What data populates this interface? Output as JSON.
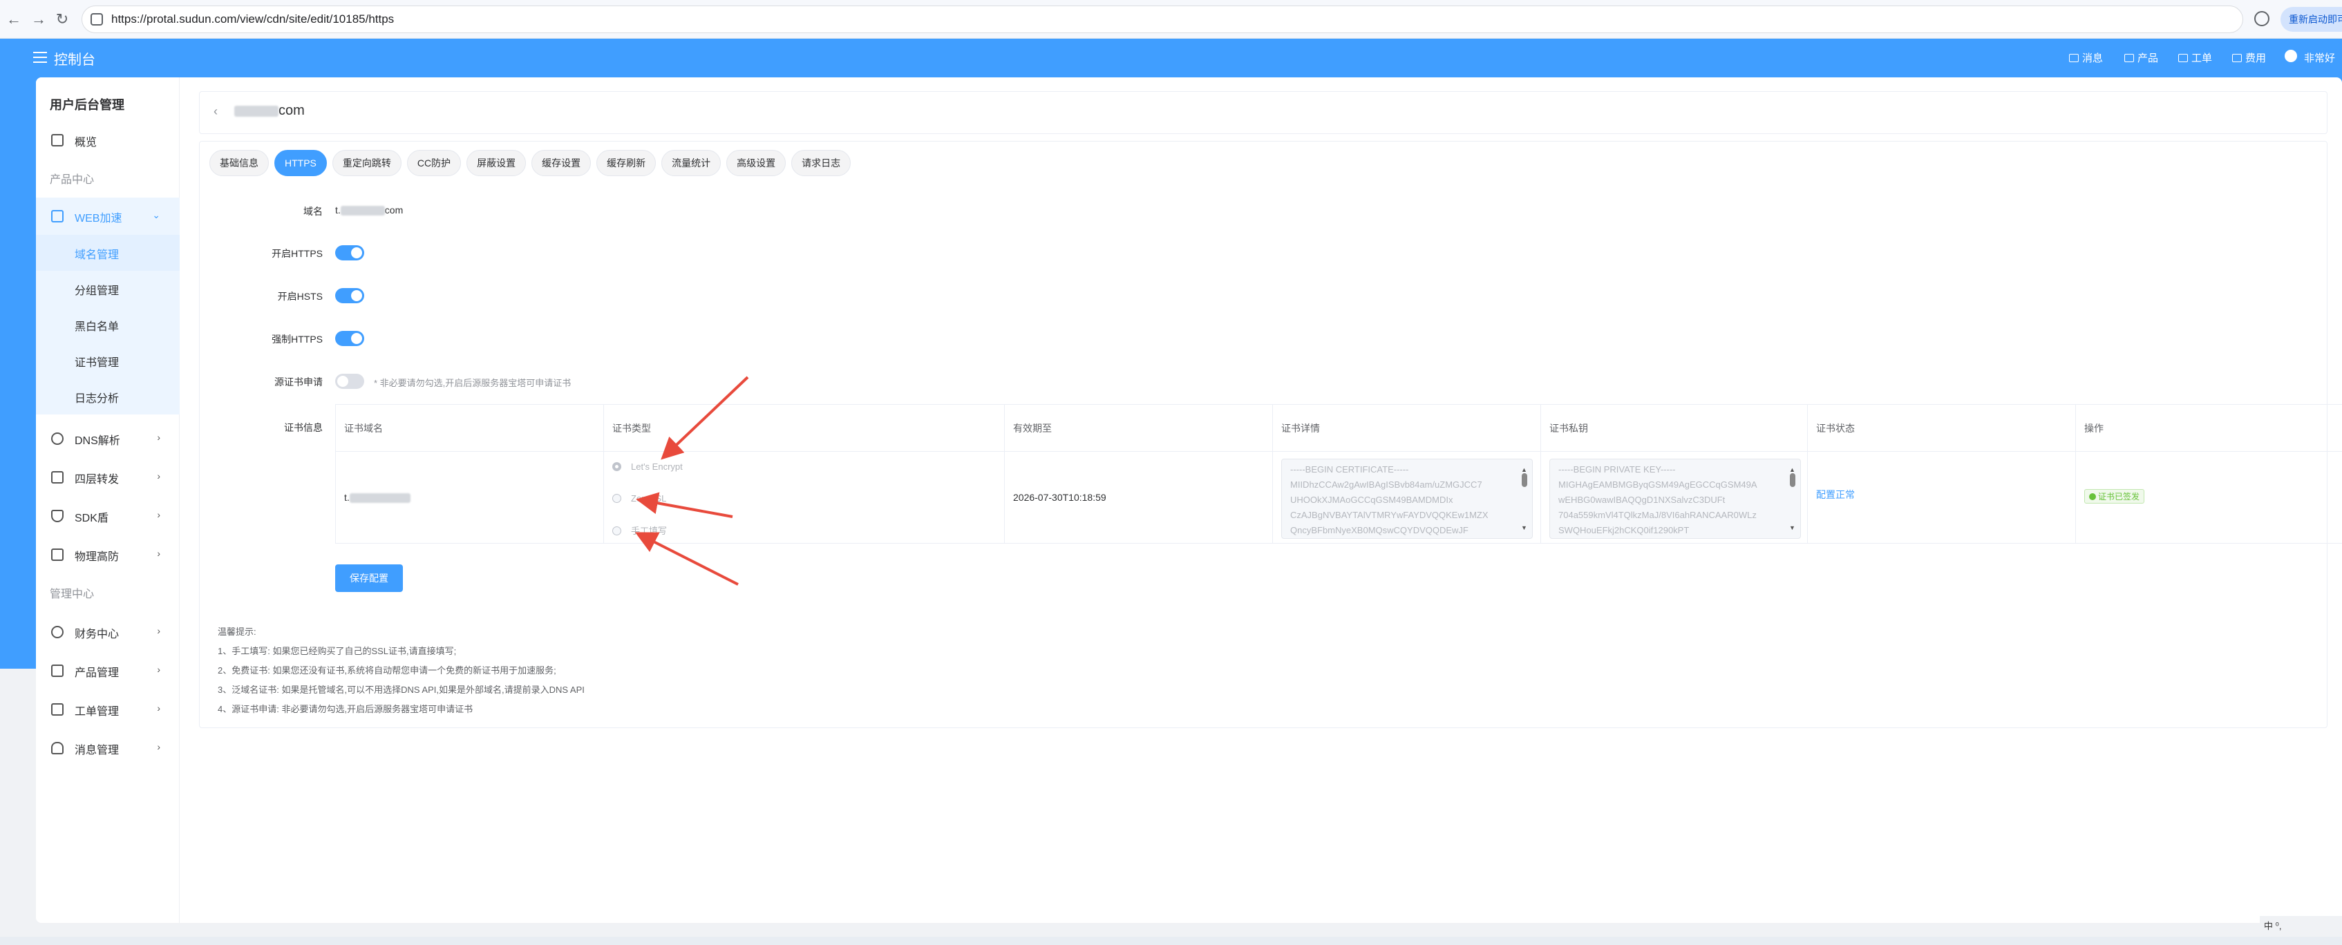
{
  "browser": {
    "url": "https://protal.sudun.com/view/cdn/site/edit/10185/https",
    "update_button": "重新启动即可更新"
  },
  "header": {
    "title": "控制台",
    "items": [
      {
        "label": "消息",
        "icon": "mail-icon"
      },
      {
        "label": "产品",
        "icon": "box-icon"
      },
      {
        "label": "工单",
        "icon": "ticket-icon"
      },
      {
        "label": "费用",
        "icon": "folder-icon"
      },
      {
        "label": "非常好",
        "icon": "user-icon"
      }
    ]
  },
  "sidebar": {
    "title": "用户后台管理",
    "overview": "概览",
    "group_products": "产品中心",
    "web_accel": "WEB加速",
    "web_sub": [
      "域名管理",
      "分组管理",
      "黑白名单",
      "证书管理",
      "日志分析"
    ],
    "items": [
      "DNS解析",
      "四层转发",
      "SDK盾",
      "物理高防"
    ],
    "group_mgmt": "管理中心",
    "mgmt_items": [
      "财务中心",
      "产品管理",
      "工单管理",
      "消息管理"
    ]
  },
  "page": {
    "domain_suffix": "com",
    "tabs": [
      "基础信息",
      "HTTPS",
      "重定向跳转",
      "CC防护",
      "屏蔽设置",
      "缓存设置",
      "缓存刷新",
      "流量统计",
      "高级设置",
      "请求日志"
    ],
    "active_tab": "HTTPS"
  },
  "form": {
    "domain_label": "域名",
    "domain_prefix": "t.",
    "domain_suffix": "com",
    "https_label": "开启HTTPS",
    "hsts_label": "开启HSTS",
    "force_https_label": "强制HTTPS",
    "origin_cert_label": "源证书申请",
    "origin_cert_hint": "* 非必要请勿勾选,开启后源服务器宝塔可申请证书",
    "cert_info_label": "证书信息"
  },
  "cert_table": {
    "headers": [
      "证书域名",
      "证书类型",
      "有效期至",
      "证书详情",
      "证书私钥",
      "证书状态",
      "操作"
    ],
    "domain_prefix": "t.",
    "types": [
      "Let's Encrypt",
      "ZeroSSL",
      "手工填写"
    ],
    "expiry": "2026-07-30T10:18:59",
    "cert_lines": [
      "-----BEGIN CERTIFICATE-----",
      "MIIDhzCCAw2gAwIBAgISBvb84am/uZMGJCC7",
      "UHOOkXJMAoGCCqGSM49BAMDMDIx",
      "CzAJBgNVBAYTAlVTMRYwFAYDVQQKEw1MZX",
      "QncyBFbmNyeXB0MQswCQYDVQQDEwJF"
    ],
    "key_lines": [
      "-----BEGIN PRIVATE KEY-----",
      "MIGHAgEAMBMGByqGSM49AgEGCCqGSM49A",
      "wEHBG0wawIBAQQgD1NXSalvzC3DUFt",
      "704a559kmVl4TQlkzMaJ/8VI6ahRANCAAR0WLz",
      "SWQHouEFkj2hCKQ0if1290kPT"
    ],
    "status": "配置正常",
    "action_badge": "证书已签发"
  },
  "save_button": "保存配置",
  "tips": [
    "温馨提示:",
    "1、手工填写: 如果您已经购买了自己的SSL证书,请直接填写;",
    "2、免费证书: 如果您还没有证书,系统将自动帮您申请一个免费的新证书用于加速服务;",
    "3、泛域名证书: 如果是托管域名,可以不用选择DNS API,如果是外部域名,请提前录入DNS API",
    "4、源证书申请: 非必要请勿勾选,开启后源服务器宝塔可申请证书"
  ],
  "tray": "中 ⁰,"
}
